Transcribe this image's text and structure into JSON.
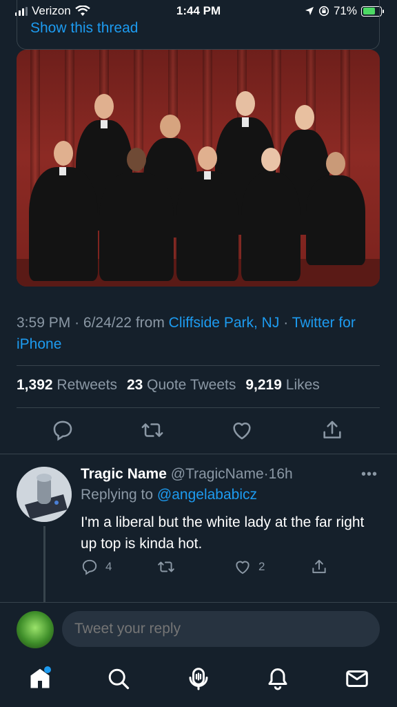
{
  "status_bar": {
    "carrier": "Verizon",
    "time": "1:44 PM",
    "battery_percent": "71%",
    "battery_level": 0.71,
    "icons": [
      "signal-icon",
      "wifi-icon",
      "location-icon",
      "orientation-lock-icon",
      "battery-charging-icon"
    ]
  },
  "thread": {
    "show_thread_label": "Show this thread"
  },
  "tweet": {
    "time": "3:59 PM",
    "date": "6/24/22",
    "from_label": "from",
    "location": "Cliffside Park, NJ",
    "source": "Twitter for iPhone",
    "separator": "·",
    "stats": {
      "retweets_count": "1,392",
      "retweets_label": "Retweets",
      "quotes_count": "23",
      "quotes_label": "Quote Tweets",
      "likes_count": "9,219",
      "likes_label": "Likes"
    }
  },
  "reply": {
    "display_name": "Tragic Name",
    "handle": "@TragicName",
    "age": "16h",
    "replying_to_label": "Replying to",
    "replying_to_handle": "@angelababicz",
    "text": "I'm a liberal but the white lady at the far right up top is kinda hot.",
    "reply_count": "4",
    "like_count": "2"
  },
  "compose": {
    "placeholder": "Tweet your reply"
  },
  "colors": {
    "background": "#15202b",
    "accent": "#1d9bf0",
    "muted": "#8b98a5",
    "divider": "#38444d"
  }
}
